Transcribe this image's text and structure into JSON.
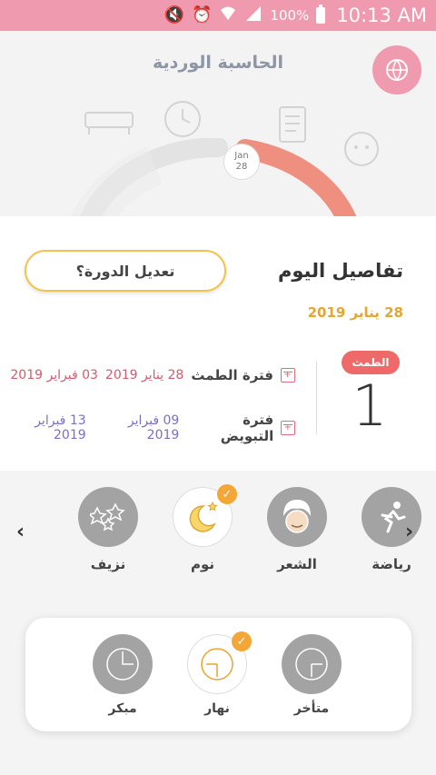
{
  "status": {
    "battery": "100%",
    "time": "10:13 AM"
  },
  "header": {
    "title": "الحاسبة الوردية",
    "cycle_date_month": "Jan",
    "cycle_date_day": "28"
  },
  "today": {
    "title": "تفاصيل اليوم",
    "date": "28 يناير 2019",
    "edit_label": "تعديل الدورة؟",
    "phase_badge": "الطمث",
    "day_number": "1"
  },
  "periods": [
    {
      "label": "فترة الطمث",
      "from": "28 يناير 2019",
      "to": "03 فبراير 2019",
      "color": "#d65a6e"
    },
    {
      "label": "فترة التبويض",
      "from": "09 فبراير 2019",
      "to": "13 فبراير 2019",
      "color": "#7b6fc4"
    }
  ],
  "categories": [
    {
      "label": "رياضة",
      "icon": "running-icon"
    },
    {
      "label": "الشعر",
      "icon": "hair-icon"
    },
    {
      "label": "نوم",
      "icon": "sleep-moon-icon",
      "selected": true
    },
    {
      "label": "نزيف",
      "icon": "bleeding-icon"
    }
  ],
  "times": [
    {
      "label": "متأخر",
      "icon": "clock-late-icon"
    },
    {
      "label": "نهار",
      "icon": "clock-day-icon",
      "selected": true
    },
    {
      "label": "مبكر",
      "icon": "clock-early-icon"
    }
  ],
  "colors": {
    "accent_pink": "#ef9aae",
    "accent_yellow": "#f4c34e",
    "badge_red": "#ee6a6a",
    "check_orange": "#f3a736"
  }
}
